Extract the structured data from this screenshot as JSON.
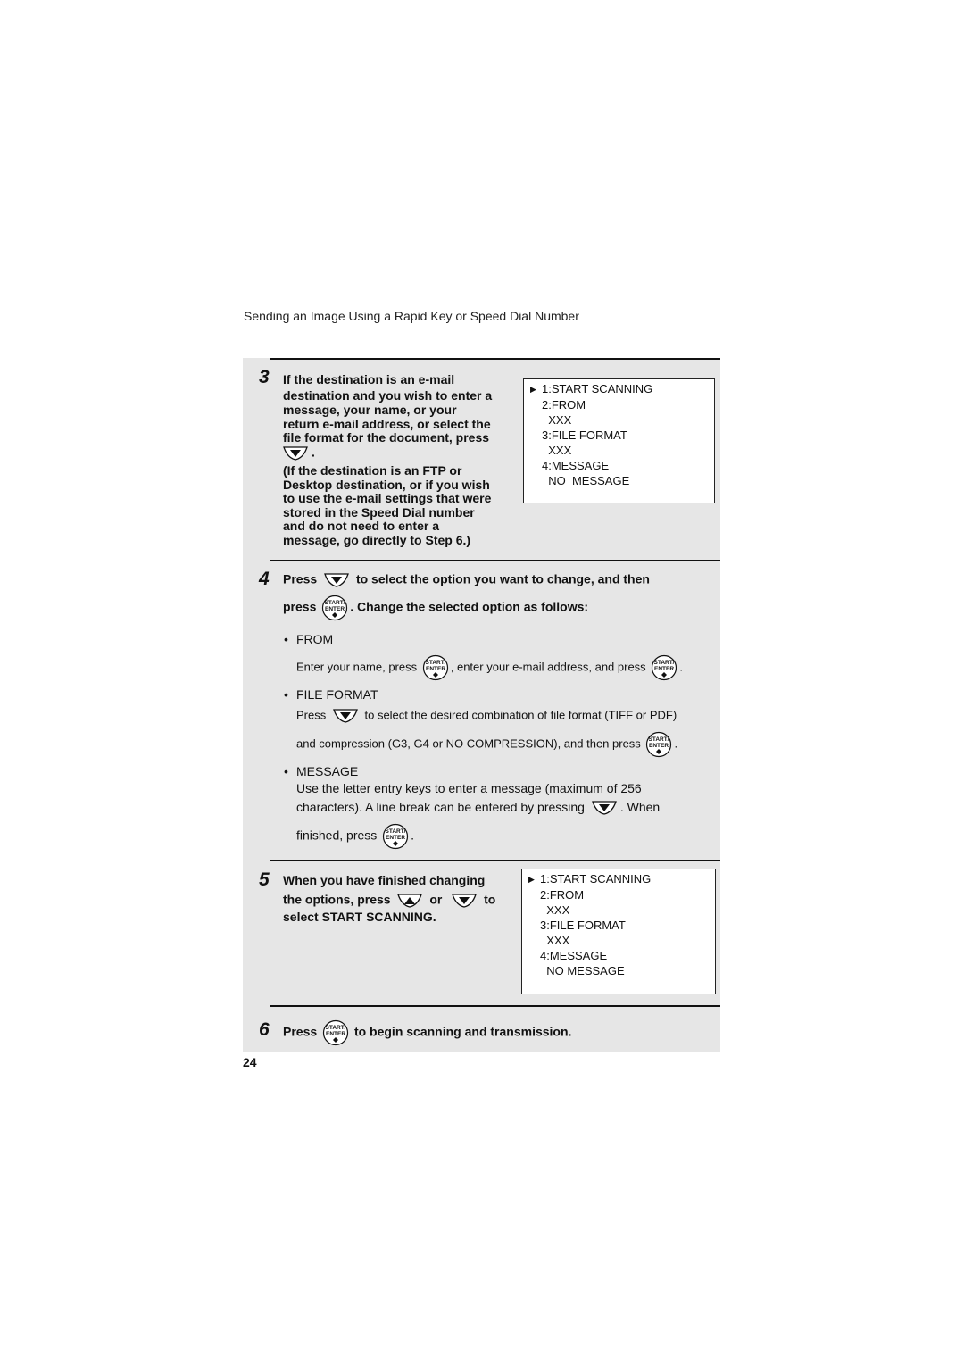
{
  "header": {
    "title": "Sending an Image Using a Rapid Key or Speed Dial Number"
  },
  "steps": {
    "s3": {
      "number": "3",
      "lines": [
        "If the destination is an e-mail",
        "destination and you wish to enter a",
        "message, your name, or your",
        "return e-mail address, or select the",
        "file format for the document, press"
      ],
      "after_icon": ".",
      "note_lines": [
        "(If the destination is an FTP or",
        "Desktop destination, or if you wish",
        "to use the e-mail settings that were",
        "stored in the Speed Dial number",
        "and do not need to enter a",
        "message, go directly to Step 6.)"
      ],
      "display": {
        "pointer": "▶",
        "rows": [
          "1:START SCANNING",
          "2:FROM",
          "  XXX",
          "3:FILE FORMAT",
          "  XXX",
          "4:MESSAGE",
          "  NO  MESSAGE"
        ]
      }
    },
    "s4": {
      "number": "4",
      "line1_a": "Press",
      "line1_b": "to select the option you want to change, and then",
      "line2_a": "press",
      "line2_b": ". Change the selected option as follows:",
      "options": {
        "from": {
          "bullet": "•",
          "title": "FROM",
          "t1": "Enter your name, press",
          "t2": ", enter your e-mail address, and press",
          "t3": "."
        },
        "file_format": {
          "bullet": "•",
          "title": "FILE FORMAT",
          "l1a": "Press",
          "l1b": "to select the desired combination of file format (TIFF or PDF)",
          "l2a": "and compression (G3, G4 or NO COMPRESSION), and then press",
          "l2b": "."
        },
        "message": {
          "bullet": "•",
          "title": "MESSAGE",
          "l1": "Use the letter entry keys to enter a message (maximum of 256",
          "l2a": "characters). A line break can be entered by pressing",
          "l2b": ". When",
          "l3a": "finished, press",
          "l3b": "."
        }
      }
    },
    "s5": {
      "number": "5",
      "line1": "When you have finished changing",
      "line2_a": "the options, press",
      "line2_b": "or",
      "line2_c": "to",
      "line3": "select START SCANNING.",
      "display": {
        "pointer": "▶",
        "rows": [
          "1:START SCANNING",
          "2:FROM",
          "  XXX",
          "3:FILE FORMAT",
          "  XXX",
          "4:MESSAGE",
          "  NO MESSAGE"
        ]
      }
    },
    "s6": {
      "number": "6",
      "line_a": "Press",
      "line_b": "to begin scanning and transmission."
    }
  },
  "buttons": {
    "enter_top": "START/",
    "enter_bottom": "ENTER",
    "down_icon": "down-arrow-key",
    "up_icon": "up-arrow-key"
  },
  "page_number": "24"
}
